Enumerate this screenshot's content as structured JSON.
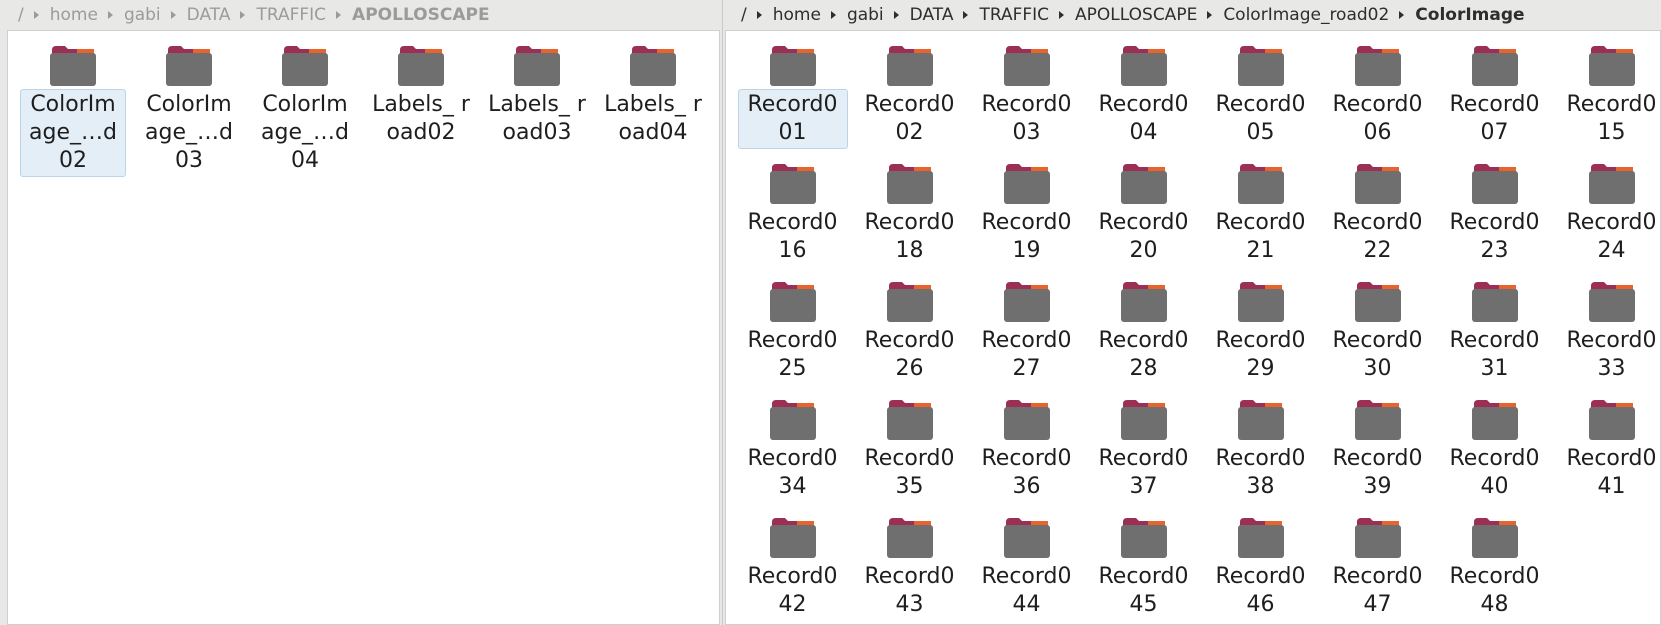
{
  "left_pane": {
    "breadcrumb": [
      "/",
      "home",
      "gabi",
      "DATA",
      "TRAFFIC",
      "APOLLOSCAPE"
    ],
    "folders": [
      {
        "label": "ColorImage_…d02",
        "selected": true
      },
      {
        "label": "ColorImage_…d03"
      },
      {
        "label": "ColorImage_…d04"
      },
      {
        "label": "Labels_ road02"
      },
      {
        "label": "Labels_ road03"
      },
      {
        "label": "Labels_ road04"
      }
    ]
  },
  "right_pane": {
    "breadcrumb": [
      "/",
      "home",
      "gabi",
      "DATA",
      "TRAFFIC",
      "APOLLOSCAPE",
      "ColorImage_road02",
      "ColorImage"
    ],
    "folders": [
      {
        "label": "Record001",
        "selected": true
      },
      {
        "label": "Record002"
      },
      {
        "label": "Record003"
      },
      {
        "label": "Record004"
      },
      {
        "label": "Record005"
      },
      {
        "label": "Record006"
      },
      {
        "label": "Record007"
      },
      {
        "label": "Record015"
      },
      {
        "label": "Record016"
      },
      {
        "label": "Record018"
      },
      {
        "label": "Record019"
      },
      {
        "label": "Record020"
      },
      {
        "label": "Record021"
      },
      {
        "label": "Record022"
      },
      {
        "label": "Record023"
      },
      {
        "label": "Record024"
      },
      {
        "label": "Record025"
      },
      {
        "label": "Record026"
      },
      {
        "label": "Record027"
      },
      {
        "label": "Record028"
      },
      {
        "label": "Record029"
      },
      {
        "label": "Record030"
      },
      {
        "label": "Record031"
      },
      {
        "label": "Record033"
      },
      {
        "label": "Record034"
      },
      {
        "label": "Record035"
      },
      {
        "label": "Record036"
      },
      {
        "label": "Record037"
      },
      {
        "label": "Record038"
      },
      {
        "label": "Record039"
      },
      {
        "label": "Record040"
      },
      {
        "label": "Record041"
      },
      {
        "label": "Record042"
      },
      {
        "label": "Record043"
      },
      {
        "label": "Record044"
      },
      {
        "label": "Record045"
      },
      {
        "label": "Record046"
      },
      {
        "label": "Record047"
      },
      {
        "label": "Record048"
      }
    ]
  },
  "icons": {
    "folder": "folder-icon"
  },
  "colors": {
    "folder_body": "#6f6f6f",
    "folder_tab": "#9c2f55",
    "folder_accent": "#e8642c",
    "selection_fill": "#e3eef7",
    "selection_border": "#bcd3e8"
  }
}
